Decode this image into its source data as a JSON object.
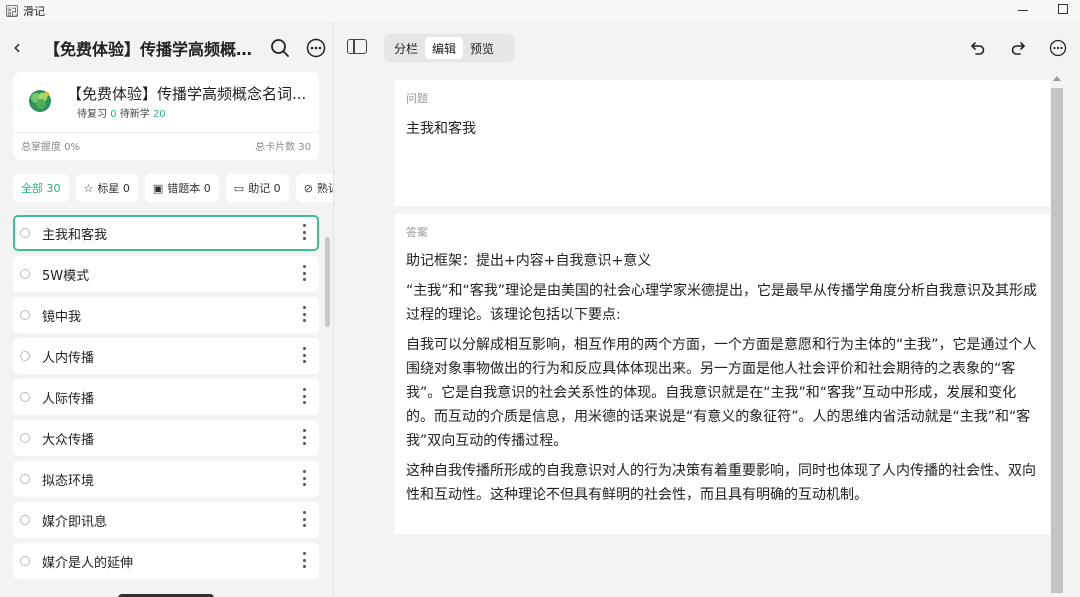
{
  "window": {
    "title": "滑记",
    "app_icon_glyph": "記"
  },
  "left": {
    "back_glyph": "‹",
    "title": "【免费体验】传播学高频概念...",
    "deck": {
      "title": "【免费体验】传播学高频概念名词...",
      "review_label": "待复习",
      "review_count": "0",
      "new_label": "待新学",
      "new_count": "20",
      "mastery": "总掌握度 0%",
      "total": "总卡片数 30"
    },
    "filters": [
      {
        "icon": "",
        "label": "全部 30"
      },
      {
        "icon": "☆",
        "label": "标星 0"
      },
      {
        "icon": "▣",
        "label": "错题本 0"
      },
      {
        "icon": "▭",
        "label": "助记 0"
      },
      {
        "icon": "⊘",
        "label": "熟记"
      }
    ],
    "cards": [
      {
        "label": "主我和客我"
      },
      {
        "label": "5W模式"
      },
      {
        "label": "镜中我"
      },
      {
        "label": "人内传播"
      },
      {
        "label": "人际传播"
      },
      {
        "label": "大众传播"
      },
      {
        "label": "拟态环境"
      },
      {
        "label": "媒介即讯息"
      },
      {
        "label": "媒介是人的延伸"
      }
    ]
  },
  "toolbar": {
    "modes": [
      {
        "label": "分栏"
      },
      {
        "label": "编辑"
      },
      {
        "label": "预览"
      }
    ]
  },
  "editor": {
    "question_label": "问题",
    "question_text": "主我和客我",
    "answer_label": "答案",
    "answer_paragraphs": [
      "助记框架：提出+内容+自我意识+意义",
      "“主我”和“客我”理论是由美国的社会心理学家米德提出，它是最早从传播学角度分析自我意识及其形成过程的理论。该理论包括以下要点:",
      "自我可以分解成相互影响，相互作用的两个方面，一个方面是意愿和行为主体的“主我”，它是通过个人围绕对象事物做出的行为和反应具体体现出来。另一方面是他人社会评价和社会期待的之表象的“客我”。它是自我意识的社会关系性的体现。自我意识就是在“主我”和“客我”互动中形成，发展和变化的。而互动的介质是信息，用米德的话来说是“有意义的象征符”。人的思维内省活动就是“主我”和“客我”双向互动的传播过程。",
      "这种自我传播所形成的自我意识对人的行为决策有着重要影响，同时也体现了人内传播的社会性、双向性和互动性。这种理论不但具有鲜明的社会性，而且具有明确的互动机制。"
    ]
  },
  "colors": {
    "accent": "#27b17b",
    "selected_border": "#3cc08e"
  }
}
